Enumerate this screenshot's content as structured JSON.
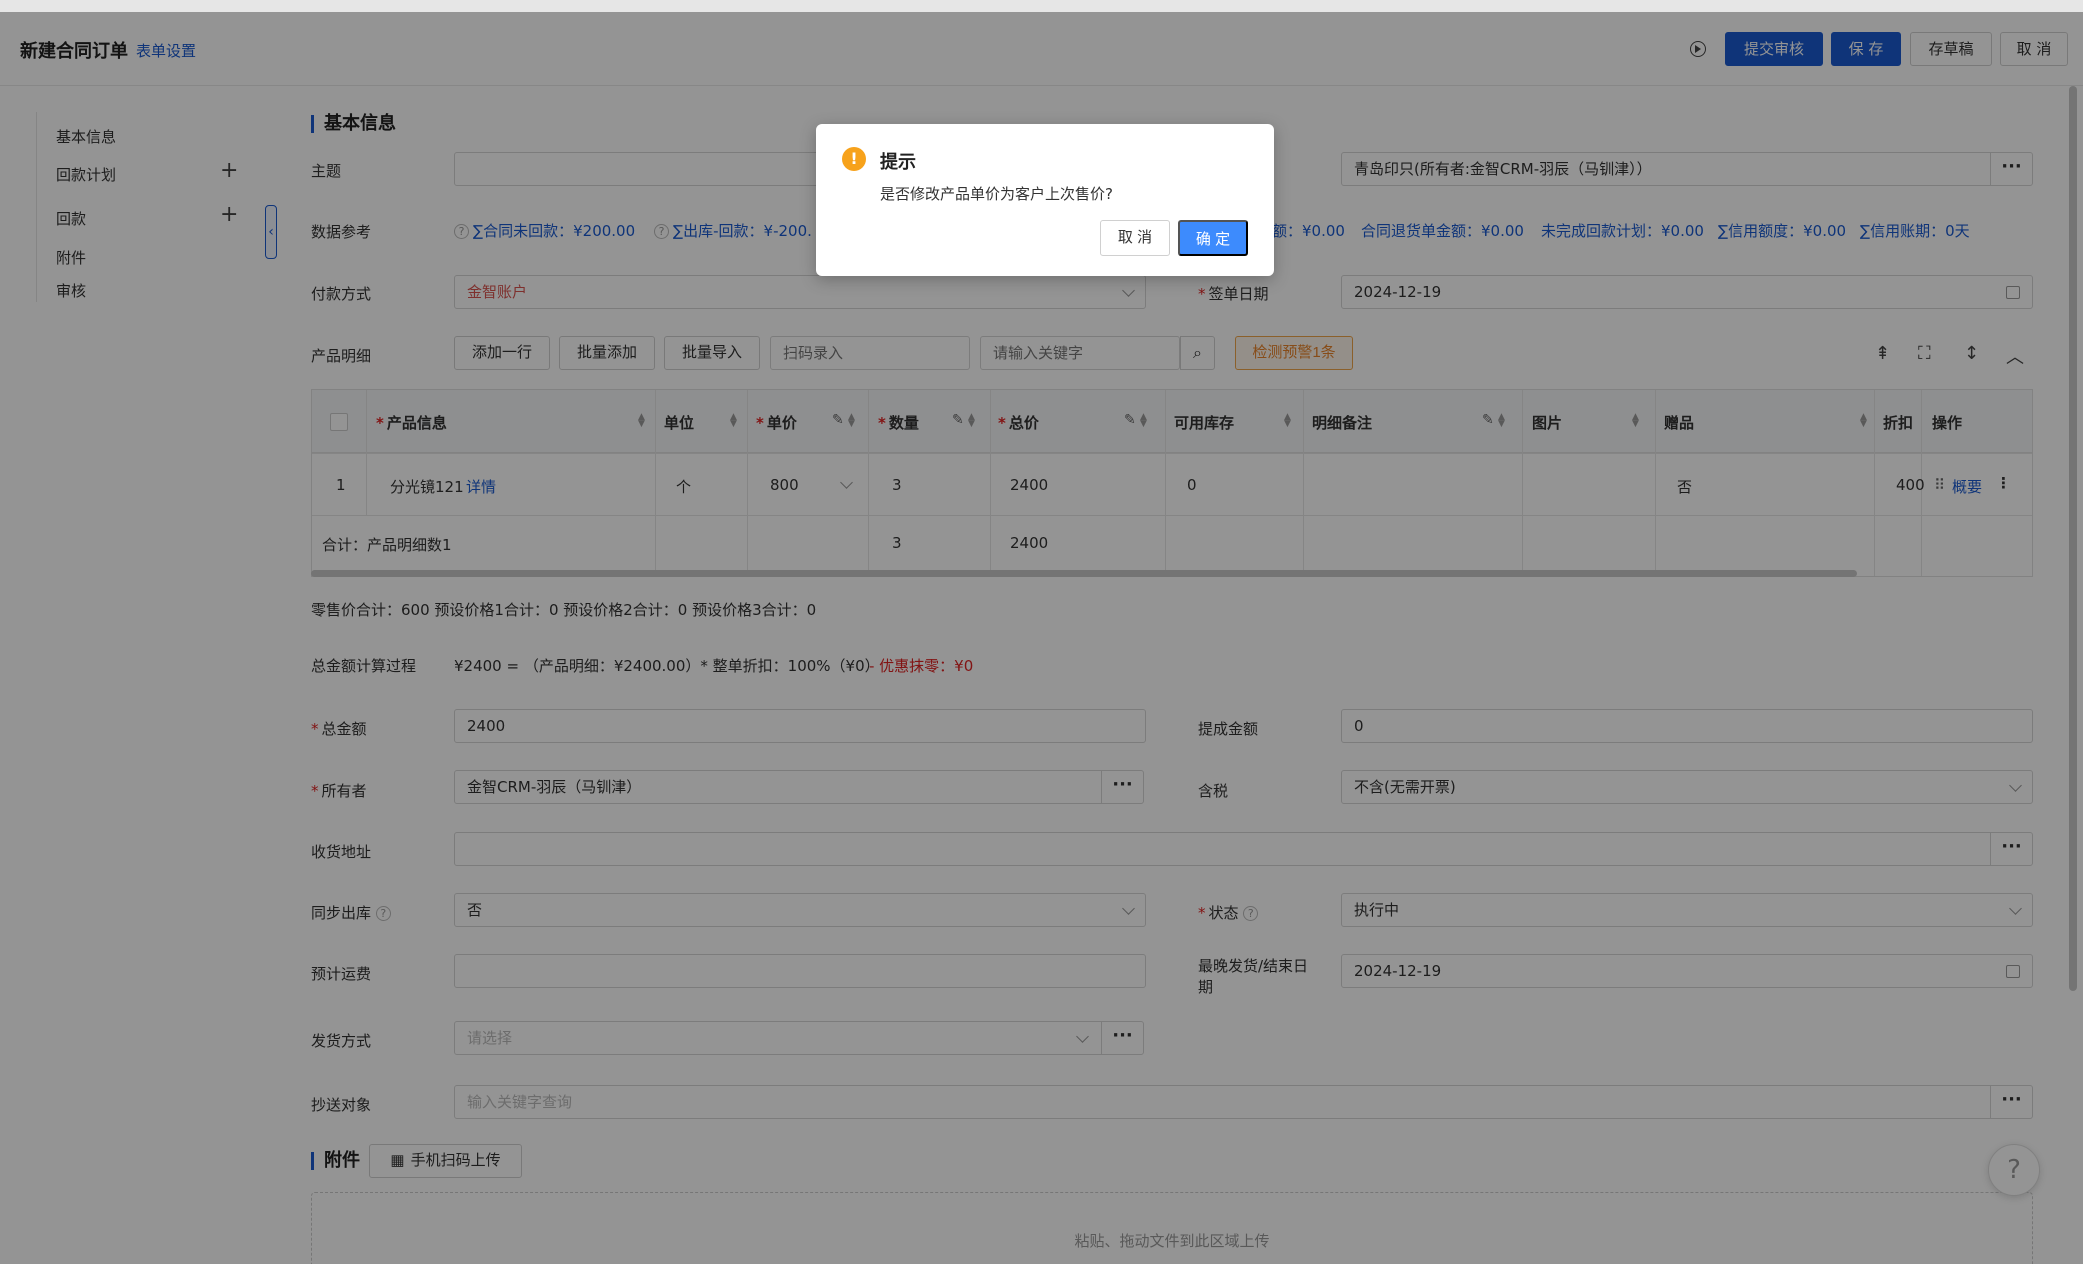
{
  "header": {
    "title": "新建合同订单",
    "form_settings": "表单设置",
    "submit_review": "提交审核",
    "save": "保 存",
    "save_draft": "存草稿",
    "cancel": "取 消"
  },
  "sidenav": {
    "items": [
      {
        "label": "基本信息"
      },
      {
        "label": "回款计划"
      },
      {
        "label": "回款"
      },
      {
        "label": "附件"
      },
      {
        "label": "审核"
      }
    ]
  },
  "basic": {
    "section_title": "基本信息",
    "subject_label": "主题",
    "customer_value": "青岛印只(所有者:金智CRM-羽辰（马钏津））",
    "data_ref_label": "数据参考",
    "refs": [
      "∑合同未回款：¥200.00",
      "∑出库-回款：¥-200.",
      "额：¥0.00",
      "合同退货单金额：¥0.00",
      "未完成回款计划：¥0.00",
      "∑信用额度：¥0.00",
      "∑信用账期：0天"
    ],
    "payment_label": "付款方式",
    "payment_value": "金智账户",
    "sign_date_label": "签单日期",
    "sign_date_value": "2024-12-19"
  },
  "products": {
    "label": "产品明细",
    "add_row": "添加一行",
    "batch_add": "批量添加",
    "batch_import": "批量导入",
    "scan_placeholder": "扫码录入",
    "keyword_placeholder": "请输入关键字",
    "detect_warning": "检测预警1条",
    "columns": [
      "产品信息",
      "单位",
      "单价",
      "数量",
      "总价",
      "可用库存",
      "明细备注",
      "图片",
      "赠品",
      "折扣",
      "操作"
    ],
    "row": {
      "index": "1",
      "product": "分光镜121",
      "detail_link": "详情",
      "unit": "个",
      "price": "800",
      "qty": "3",
      "total": "2400",
      "stock": "0",
      "gift": "否",
      "discount": "400",
      "summary_link": "概要"
    },
    "footer": {
      "label": "合计：产品明细数1",
      "qty": "3",
      "total": "2400"
    }
  },
  "summary": {
    "retail_line": "零售价合计：600  预设价格1合计：0  预设价格2合计：0  预设价格3合计：0",
    "calc_label": "总金额计算过程",
    "calc_text": "¥2400 =  （产品明细：¥2400.00）* 整单折扣：100%（¥0）",
    "calc_red": "- 优惠抹零：¥0"
  },
  "fields": {
    "total_label": "总金额",
    "total_value": "2400",
    "commission_label": "提成金额",
    "commission_value": "0",
    "owner_label": "所有者",
    "owner_value": "金智CRM-羽辰（马钏津）",
    "tax_label": "含税",
    "tax_value": "不含(无需开票)",
    "address_label": "收货地址",
    "sync_label": "同步出库",
    "sync_value": "否",
    "status_label": "状态",
    "status_value": "执行中",
    "freight_label": "预计运费",
    "latest_date_label": "最晚发货/结束日期",
    "latest_date_value": "2024-12-19",
    "ship_label": "发货方式",
    "ship_placeholder": "请选择",
    "cc_label": "抄送对象",
    "cc_placeholder": "输入关键字查询"
  },
  "attachments": {
    "section_title": "附件",
    "scan_upload": "手机扫码上传",
    "drop_text": "粘贴、拖动文件到此区域上传"
  },
  "dialog": {
    "title": "提示",
    "message": "是否修改产品单价为客户上次售价?",
    "cancel": "取 消",
    "ok": "确 定"
  },
  "colors": {
    "primary": "#1a5bd1",
    "warning": "#f7a21b",
    "dialog_ok": "#3d8bfd",
    "required": "#e02424"
  }
}
